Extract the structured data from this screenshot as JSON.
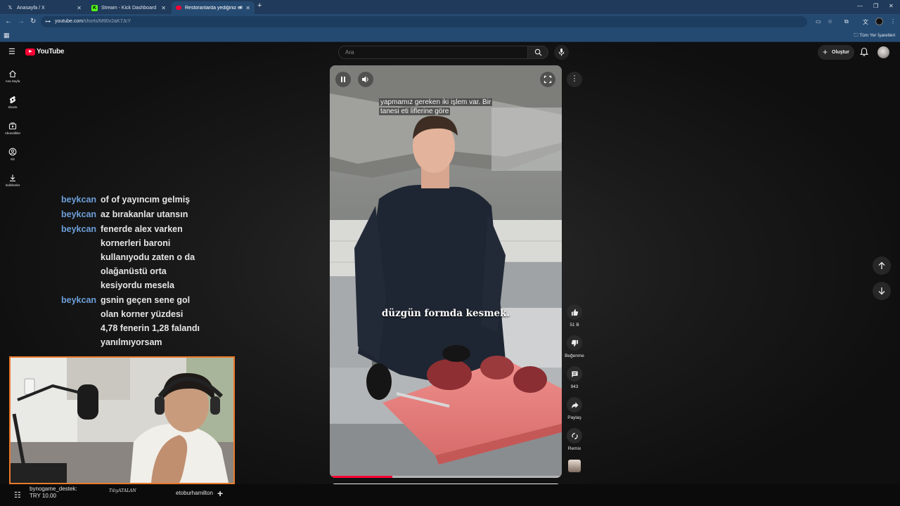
{
  "browser": {
    "tabs": [
      {
        "title": "Anasayfa / X",
        "favicon": "x-logo-icon",
        "active": false
      },
      {
        "title": "Stream - Kick Dashboard",
        "favicon": "kick-logo-icon",
        "active": false
      },
      {
        "title": "Restoranlarda yediğiniz et",
        "favicon": "youtube-logo-icon",
        "active": true
      }
    ],
    "url_host": "youtube.com",
    "url_path": "/shorts/M90v2aK7JcY",
    "bookmarks_all_label": "Tüm Yer İşaretleri"
  },
  "youtube": {
    "logo_text": "YouTube",
    "search_placeholder": "Ara",
    "create_label": "Oluştur",
    "sidebar": [
      {
        "label": "Ana Sayfa",
        "icon": "home-icon"
      },
      {
        "label": "Shorts",
        "icon": "shorts-icon"
      },
      {
        "label": "Abonelikler",
        "icon": "subscriptions-icon"
      },
      {
        "label": "Siz",
        "icon": "you-icon"
      },
      {
        "label": "İndirilenler",
        "icon": "downloads-icon"
      }
    ],
    "video": {
      "caption_top": "yapmamız gereken iki işlem var. Bir tanesi eti liflerine göre",
      "caption_mid": "düzgün formda kesmek.",
      "progress": 0.27
    },
    "actions": {
      "like_count": "51 B",
      "dislike_label": "Beğenme",
      "comment_count": "943",
      "share_label": "Paylaş",
      "remix_label": "Remix"
    }
  },
  "stream_overlay": {
    "chat": [
      {
        "user": "beykcan",
        "text": "of of yayıncım gelmiş"
      },
      {
        "user": "beykcan",
        "text": "az bırakanlar utansın"
      },
      {
        "user": "beykcan",
        "text": "fenerde alex varken kornerleri baroni kullanıyodu zaten o da olağanüstü orta kesiyordu mesela"
      },
      {
        "user": "beykcan",
        "text": "gsnin geçen sene gol olan korner yüzdesi 4,78 fenerin 1,28 falandı yanılmıyorsam"
      }
    ],
    "donation_user": "bynogame_destek:",
    "donation_amount": "TRY 10.00",
    "signature": "TılıyATALAN",
    "follower": "etoburhamilton"
  },
  "colors": {
    "accent_red": "#ff0033",
    "chat_user": "#6d9fd9",
    "webcam_border": "#e97a2b",
    "chrome_blue": "#254a71"
  }
}
